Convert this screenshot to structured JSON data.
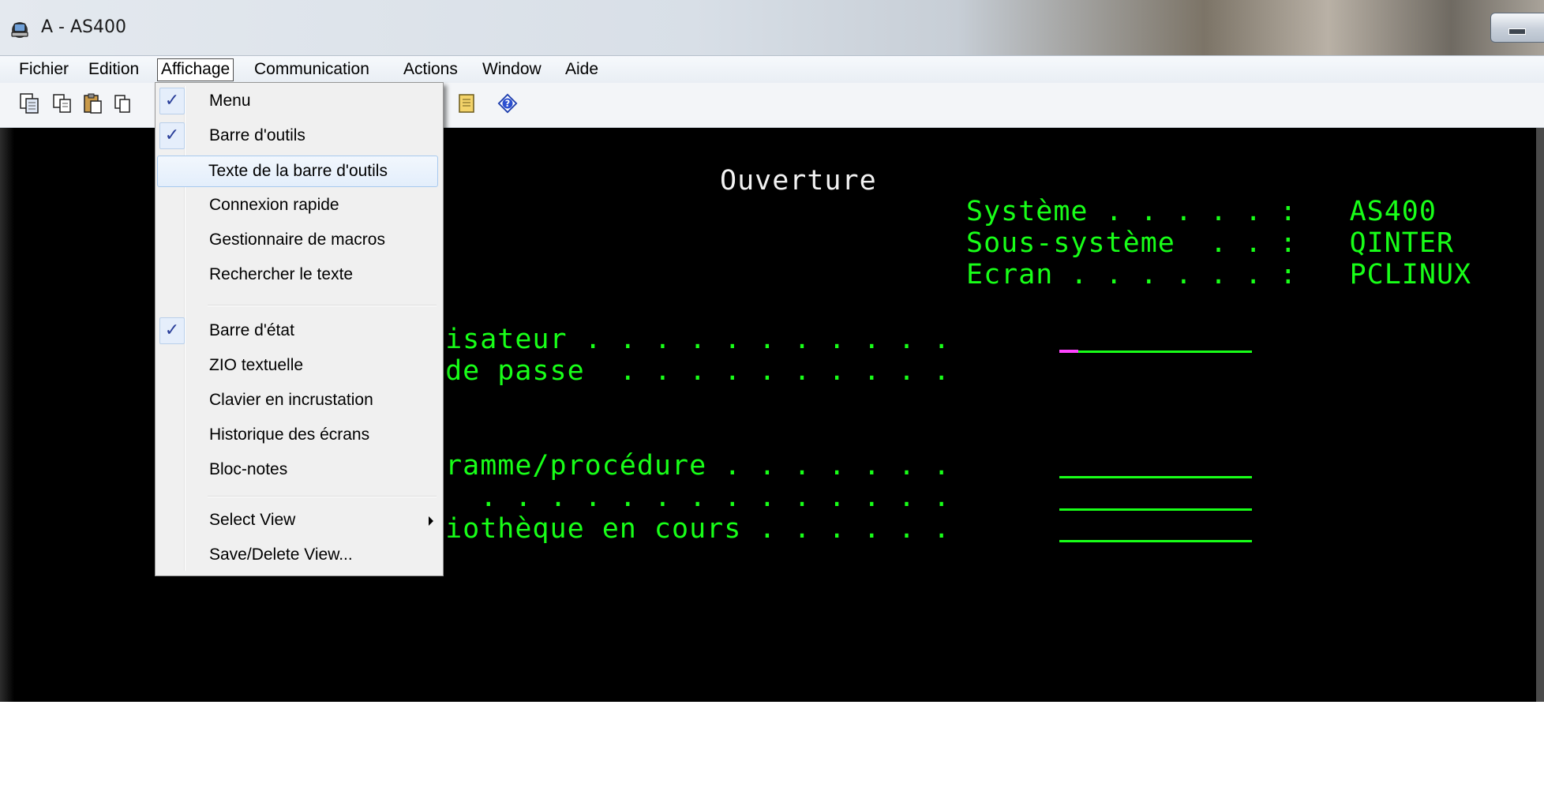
{
  "window": {
    "title": "A - AS400"
  },
  "menubar": {
    "items": [
      "Fichier",
      "Edition",
      "Affichage",
      "Communication",
      "Actions",
      "Window",
      "Aide"
    ],
    "open_item": "Affichage"
  },
  "toolbar": {
    "icons": [
      "copy-screen-icon",
      "copy-icon",
      "paste-icon",
      "copy-append-icon",
      "notepad-icon",
      "help-icon"
    ]
  },
  "dropdown": {
    "items": [
      {
        "label": "Menu",
        "checked": true
      },
      {
        "label": "Barre d'outils",
        "checked": true
      },
      {
        "label": "Texte de la barre d'outils",
        "checked": false,
        "highlighted": true
      },
      {
        "label": "Connexion rapide",
        "checked": false
      },
      {
        "label": "Gestionnaire de macros",
        "checked": false
      },
      {
        "label": "Rechercher le texte",
        "checked": false
      },
      {
        "label": "Barre d'état",
        "checked": true
      },
      {
        "label": "ZIO textuelle",
        "checked": false
      },
      {
        "label": "Clavier en incrustation",
        "checked": false
      },
      {
        "label": "Historique des écrans",
        "checked": false
      },
      {
        "label": "Bloc-notes",
        "checked": false
      },
      {
        "label": "Select View",
        "checked": false,
        "submenu": true
      },
      {
        "label": "Save/Delete View...",
        "checked": false
      }
    ],
    "check_glyph": "✓"
  },
  "terminal": {
    "title": "Ouverture",
    "system_lines": [
      "Système . . . . . :   AS400",
      "Sous-système  . . :   QINTER",
      "Ecran . . . . . . :   PCLINUX"
    ],
    "prompt_lines": [
      "lisateur . . . . . . . . . . .",
      " de passe  . . . . . . . . . .",
      "gramme/procédure . . . . . . .",
      "u  . . . . . . . . . . . . . .",
      "liothèque en cours . . . . . ."
    ],
    "colors": {
      "foreground": "#18ff18",
      "title": "#f2f2f2",
      "cursor": "#ff44ff",
      "background": "#000000"
    }
  }
}
